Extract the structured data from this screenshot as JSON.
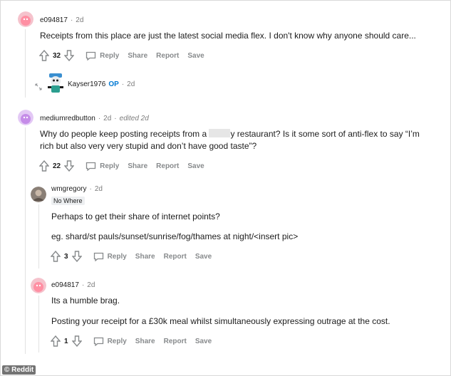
{
  "comments": [
    {
      "username": "e094817",
      "time": "2d",
      "text": "Receipts from this place are just the latest social media flex. I don't know why anyone should care...",
      "score": "32",
      "actions": [
        "Reply",
        "Share",
        "Report",
        "Save"
      ]
    },
    {
      "username": "Kayser1976",
      "op_badge": "OP",
      "time": "2d"
    },
    {
      "username": "mediumredbutton",
      "time": "2d",
      "edited": "edited 2d",
      "text_before": "Why do people keep posting receipts from a ",
      "text_after": "y restaurant? Is it some sort of anti-flex to say “I’m rich but also very very stupid and don’t have good taste”?",
      "score": "22",
      "actions": [
        "Reply",
        "Share",
        "Report",
        "Save"
      ]
    },
    {
      "username": "wmgregory",
      "time": "2d",
      "flair": "No Where",
      "paragraphs": [
        "Perhaps to get their share of internet points?",
        "eg. shard/st pauls/sunset/sunrise/fog/thames at night/<insert pic>"
      ],
      "score": "3",
      "actions": [
        "Reply",
        "Share",
        "Report",
        "Save"
      ]
    },
    {
      "username": "e094817",
      "time": "2d",
      "paragraphs": [
        "Its a humble brag.",
        "Posting your receipt for a £30k meal whilst simultaneously expressing outrage at the cost."
      ],
      "score": "1",
      "actions": [
        "Reply",
        "Share",
        "Report",
        "Save"
      ]
    }
  ],
  "watermark": "© Reddit",
  "colors": {
    "op": "#0079d3",
    "meta": "#7c7c7c",
    "action": "#878a8c",
    "avatar_pink": "#ff8fa3",
    "avatar_purple": "#c58ce8"
  }
}
